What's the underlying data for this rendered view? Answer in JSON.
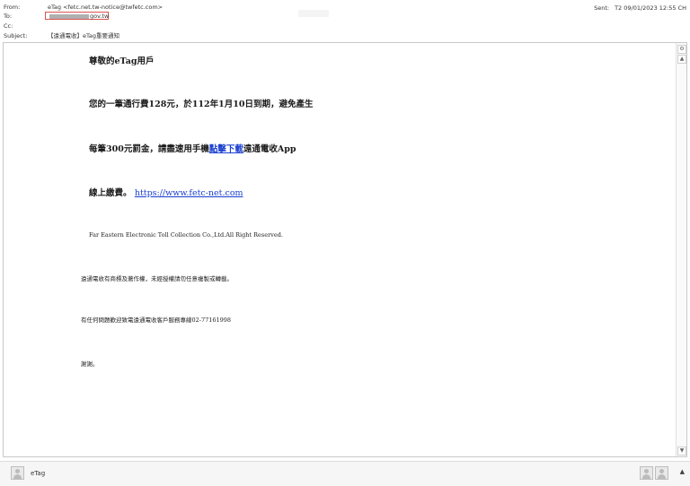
{
  "header": {
    "from_label": "From:",
    "from_value": "eTag <fetc.net.tw-notice@twfetc.com>",
    "to_label": "To:",
    "to_value": "gov.tw",
    "cc_label": "Cc:",
    "subject_label": "Subject:",
    "subject_value": "【遠通電收】eTag重要通知",
    "sent_label": "Sent:",
    "sent_value": "T2 09/01/2023 12:55 CH"
  },
  "body": {
    "greeting": "尊敬的eTag用戶",
    "line1": "您的一筆通行費128元，於112年1月10日到期，避免產生",
    "line2_pre": "每筆300元罰金，請盡速用手機",
    "line2_link": "點擊下載",
    "line2_post": "遠通電收App",
    "line3_pre": "線上繳費。",
    "line3_link": "https://www.fetc-net.com",
    "copyright": "Far Eastern Electronic Toll Collection Co.,Ltd.All Right Reserved.",
    "trademark": "遠通電收有商標及著作權，未經授權請勿任意複製或轉載。",
    "contact": "有任何問題歡迎致電遠通電收客戶服務專線02-77161998",
    "thanks": "謝謝。"
  },
  "footer": {
    "sender_name": "eTag"
  }
}
